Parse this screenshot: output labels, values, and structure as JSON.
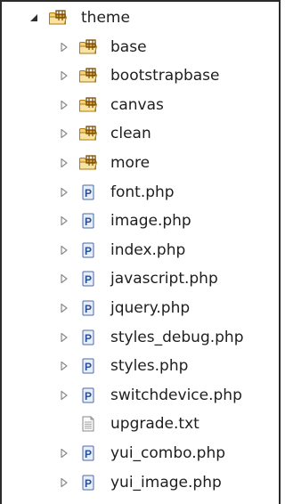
{
  "tree": {
    "root": {
      "label": "theme",
      "icon": "package-folder-icon",
      "expanded": true
    },
    "children": [
      {
        "label": "base",
        "icon": "package-folder-icon",
        "expandable": true
      },
      {
        "label": "bootstrapbase",
        "icon": "package-folder-icon",
        "expandable": true
      },
      {
        "label": "canvas",
        "icon": "package-folder-icon",
        "expandable": true
      },
      {
        "label": "clean",
        "icon": "package-folder-icon",
        "expandable": true
      },
      {
        "label": "more",
        "icon": "package-folder-icon",
        "expandable": true
      },
      {
        "label": "font.php",
        "icon": "php-file-icon",
        "expandable": true
      },
      {
        "label": "image.php",
        "icon": "php-file-icon",
        "expandable": true
      },
      {
        "label": "index.php",
        "icon": "php-file-icon",
        "expandable": true
      },
      {
        "label": "javascript.php",
        "icon": "php-file-icon",
        "expandable": true
      },
      {
        "label": "jquery.php",
        "icon": "php-file-icon",
        "expandable": true
      },
      {
        "label": "styles_debug.php",
        "icon": "php-file-icon",
        "expandable": true
      },
      {
        "label": "styles.php",
        "icon": "php-file-icon",
        "expandable": true
      },
      {
        "label": "switchdevice.php",
        "icon": "php-file-icon",
        "expandable": true
      },
      {
        "label": "upgrade.txt",
        "icon": "text-file-icon",
        "expandable": false
      },
      {
        "label": "yui_combo.php",
        "icon": "php-file-icon",
        "expandable": true
      },
      {
        "label": "yui_image.php",
        "icon": "php-file-icon",
        "expandable": true
      }
    ]
  },
  "colors": {
    "folder_fill": "#f3d27a",
    "folder_stroke": "#b07a10",
    "package_accent": "#7a4a00",
    "php_fill": "#e8eef8",
    "php_stroke": "#4a6aa8",
    "php_letter": "#2a4f9a",
    "expander": "#8a8a8a"
  }
}
